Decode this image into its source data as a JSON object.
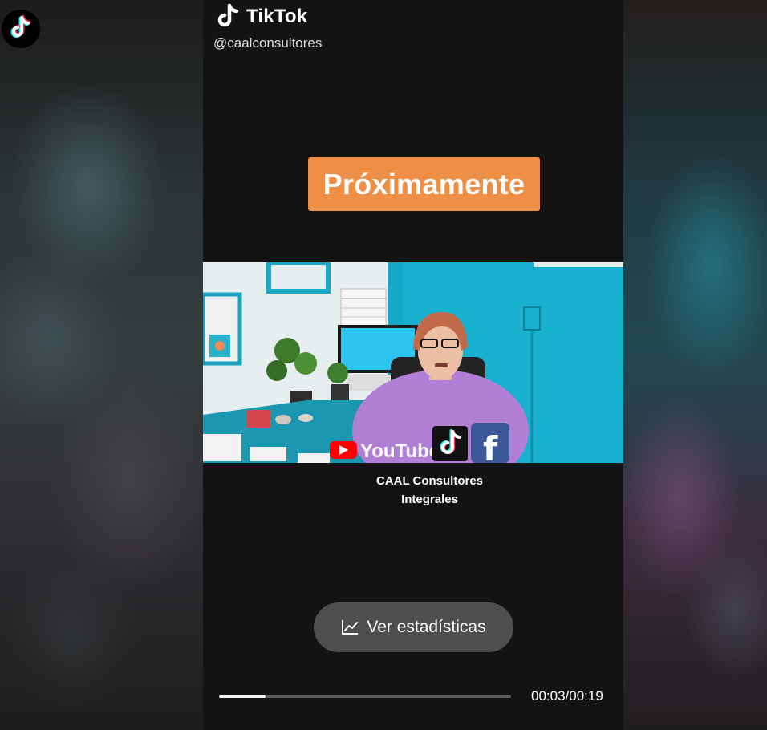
{
  "brand": {
    "name": "TikTok",
    "handle": "@caalconsultores"
  },
  "overlay": {
    "banner_text": "Próximamente",
    "banner_color": "#ef8f45"
  },
  "video_frame": {
    "youtube_label": "YouTube"
  },
  "caption": {
    "line1": "CAAL Consultores",
    "line2": "Integrales"
  },
  "stats_button": {
    "label": "Ver estadísticas",
    "icon": "line-chart-icon"
  },
  "playback": {
    "current": "00:03",
    "duration": "00:19",
    "timecode": "00:03/00:19",
    "progress_fraction": 0.158
  },
  "icons": {
    "corner_logo": "tiktok-logo-icon",
    "brand_logo": "tiktok-note-icon",
    "social": [
      "youtube-icon",
      "tiktok-icon",
      "facebook-icon"
    ]
  },
  "colors": {
    "tiktok_cyan": "#25f4ee",
    "tiktok_red": "#fe2c55",
    "youtube_red": "#ff0000",
    "facebook_blue": "#3b5998"
  }
}
